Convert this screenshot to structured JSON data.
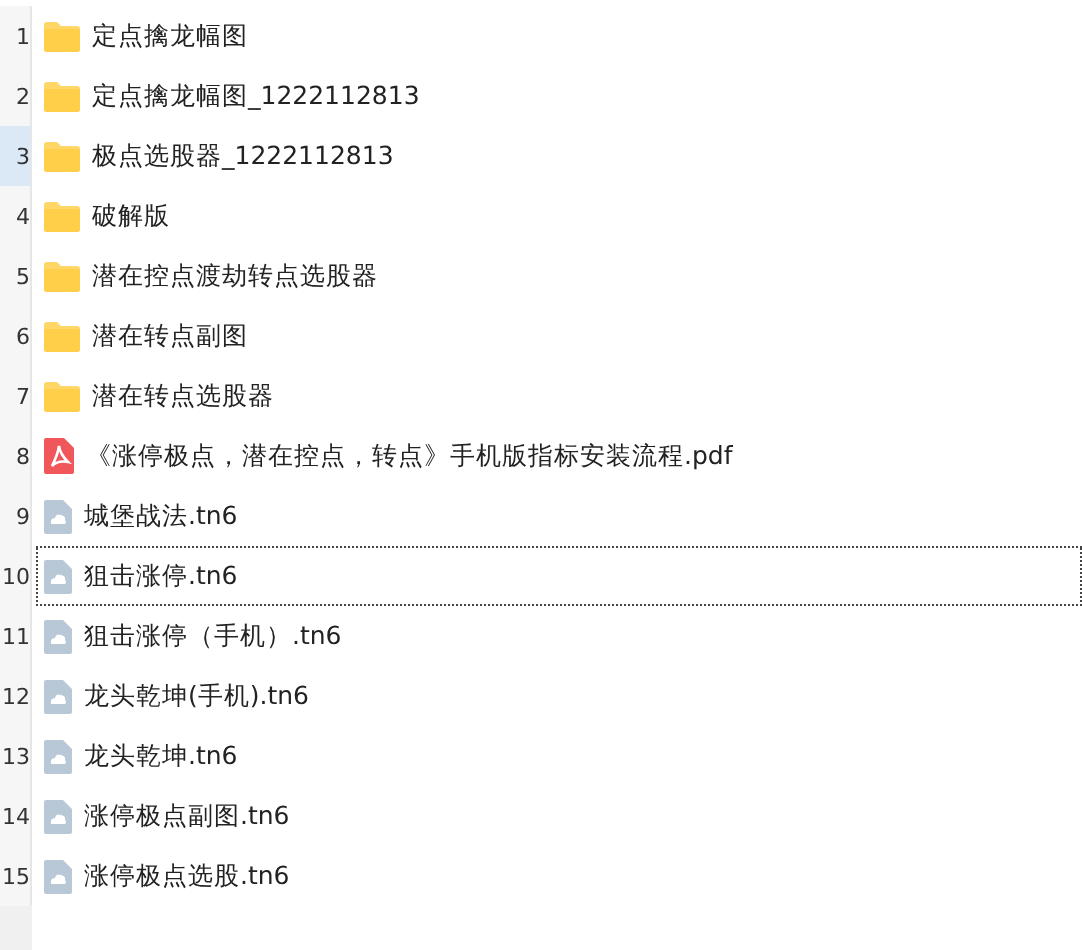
{
  "rows": [
    {
      "number": "1",
      "kind": "folder",
      "name": "定点擒龙幅图",
      "selected": false,
      "focused": false
    },
    {
      "number": "2",
      "kind": "folder",
      "name": "定点擒龙幅图_1222112813",
      "selected": false,
      "focused": false
    },
    {
      "number": "3",
      "kind": "folder",
      "name": "极点选股器_1222112813",
      "selected": true,
      "focused": false
    },
    {
      "number": "4",
      "kind": "folder",
      "name": "破解版",
      "selected": false,
      "focused": false
    },
    {
      "number": "5",
      "kind": "folder",
      "name": "潜在控点渡劫转点选股器",
      "selected": false,
      "focused": false
    },
    {
      "number": "6",
      "kind": "folder",
      "name": "潜在转点副图",
      "selected": false,
      "focused": false
    },
    {
      "number": "7",
      "kind": "folder",
      "name": "潜在转点选股器",
      "selected": false,
      "focused": false
    },
    {
      "number": "8",
      "kind": "pdf",
      "name": "《涨停极点，潜在控点，转点》手机版指标安装流程.pdf",
      "selected": false,
      "focused": false
    },
    {
      "number": "9",
      "kind": "file",
      "name": "城堡战法.tn6",
      "selected": false,
      "focused": false
    },
    {
      "number": "10",
      "kind": "file",
      "name": "狙击涨停.tn6",
      "selected": false,
      "focused": true
    },
    {
      "number": "11",
      "kind": "file",
      "name": "狙击涨停（手机）.tn6",
      "selected": false,
      "focused": false
    },
    {
      "number": "12",
      "kind": "file",
      "name": "龙头乾坤(手机).tn6",
      "selected": false,
      "focused": false
    },
    {
      "number": "13",
      "kind": "file",
      "name": "龙头乾坤.tn6",
      "selected": false,
      "focused": false
    },
    {
      "number": "14",
      "kind": "file",
      "name": "涨停极点副图.tn6",
      "selected": false,
      "focused": false
    },
    {
      "number": "15",
      "kind": "file",
      "name": "涨停极点选股.tn6",
      "selected": false,
      "focused": false
    }
  ]
}
